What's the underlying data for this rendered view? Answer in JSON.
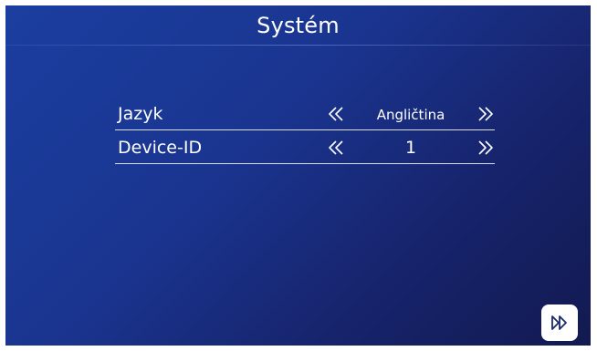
{
  "screen": {
    "title": "Systém",
    "settings": [
      {
        "label": "Jazyk",
        "value": "Angličtina",
        "prev_icon": "double-chevron-left-icon",
        "next_icon": "double-chevron-right-icon"
      },
      {
        "label": "Device-ID",
        "value": "1",
        "prev_icon": "double-chevron-left-icon",
        "next_icon": "double-chevron-right-icon"
      }
    ],
    "next_button_icon": "double-chevron-right-icon"
  },
  "colors": {
    "background_start": "#1b3ea0",
    "background_end": "#121a50",
    "text": "#ffffff",
    "divider": "#d9def0",
    "button_bg": "#ffffff",
    "button_icon": "#1a2a6a"
  }
}
